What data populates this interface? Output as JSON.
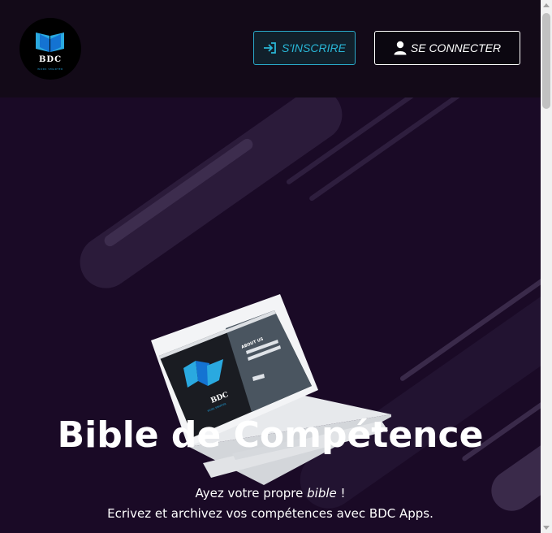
{
  "header": {
    "logo": {
      "title": "BDC",
      "subtitle": "WORK SMARTER"
    },
    "signup_label": "S'INSCRIRE",
    "login_label": "SE CONNECTER"
  },
  "hero": {
    "laptop_screen": {
      "brand": "BDC",
      "brand_sub": "WORK SMARTER",
      "panel_heading": "ABOUT US"
    },
    "title": "Bible de Compétence",
    "line1_prefix": "Ayez votre propre ",
    "line1_emph": "bible",
    "line1_suffix": " !",
    "line2": "Ecrivez et archivez vos compétences avec BDC Apps."
  },
  "colors": {
    "accent": "#29b6d6",
    "background": "#1a0a26",
    "header": "#130a18"
  }
}
